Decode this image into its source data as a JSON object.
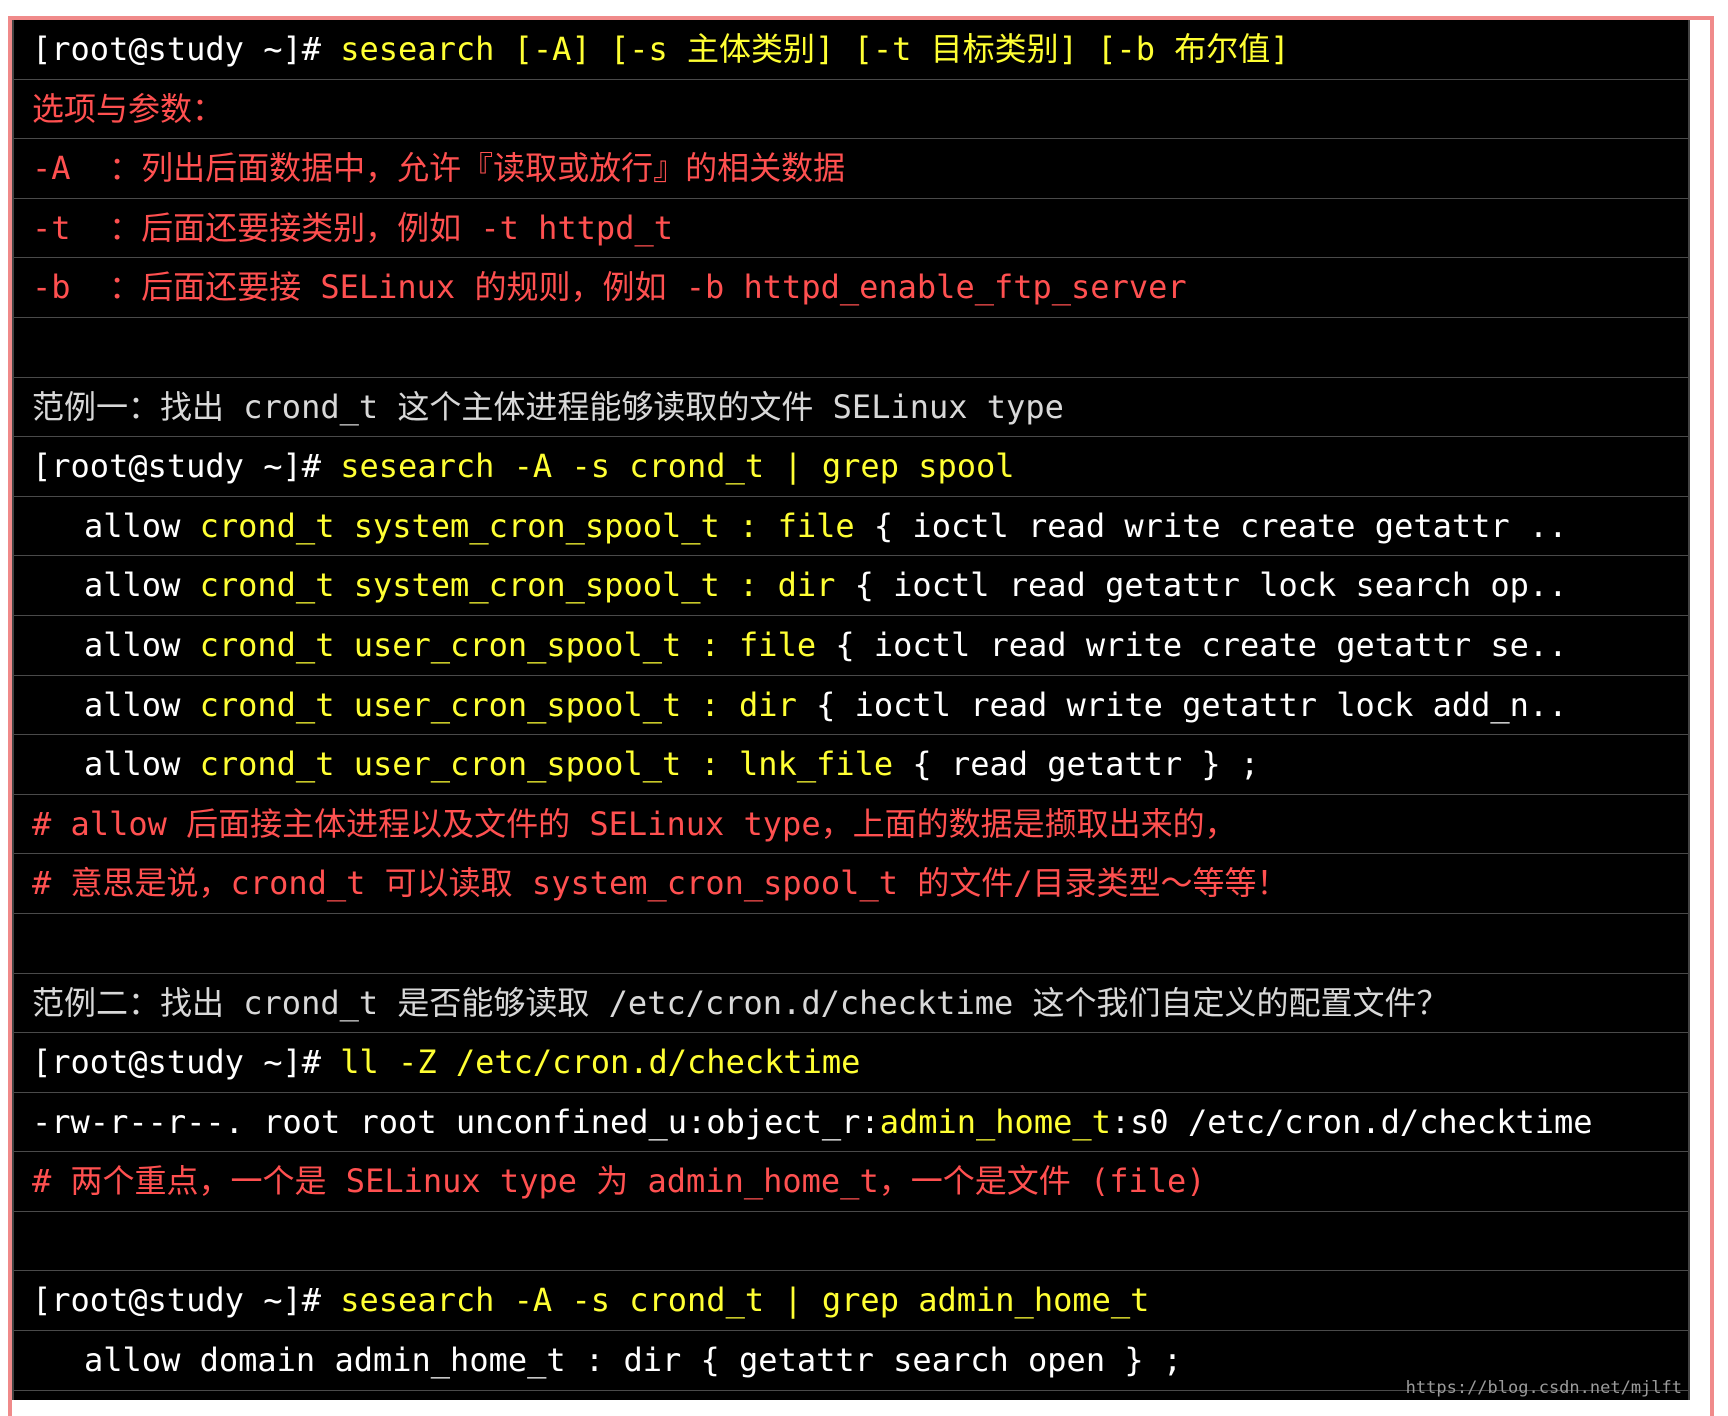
{
  "lines": [
    {
      "prompt": "[root@study ~]# ",
      "cmd": "sesearch [-A] [-s 主体类别] [-t 目标类别] [-b 布尔值]"
    },
    {
      "text": "选项与参数："
    },
    {
      "text": "-A  ：列出后面数据中，允许『读取或放行』的相关数据"
    },
    {
      "text": "-t  ：后面还要接类别，例如 -t httpd_t"
    },
    {
      "text": "-b  ：后面还要接 SELinux 的规则，例如 -b httpd_enable_ftp_server"
    },
    {
      "text": ""
    },
    {
      "text": "范例一：找出 crond_t 这个主体进程能够读取的文件 SELinux type"
    },
    {
      "prompt": "[root@study ~]# ",
      "cmd": "sesearch -A -s crond_t | grep spool"
    },
    {
      "a": "allow ",
      "b": "crond_t system_cron_spool_t : file ",
      "c": "{ ioctl read write create getattr .."
    },
    {
      "a": "allow ",
      "b": "crond_t system_cron_spool_t : dir ",
      "c": "{ ioctl read getattr lock search op.."
    },
    {
      "a": "allow ",
      "b": "crond_t user_cron_spool_t : file ",
      "c": "{ ioctl read write create getattr se.."
    },
    {
      "a": "allow ",
      "b": "crond_t user_cron_spool_t : dir ",
      "c": "{ ioctl read write getattr lock add_n.."
    },
    {
      "a": "allow ",
      "b": "crond_t user_cron_spool_t : lnk_file ",
      "c": "{ read getattr } ;"
    },
    {
      "text": "# allow 后面接主体进程以及文件的 SELinux type，上面的数据是撷取出来的，"
    },
    {
      "text": "# 意思是说，crond_t 可以读取 system_cron_spool_t 的文件/目录类型～等等！"
    },
    {
      "text": ""
    },
    {
      "text": "范例二：找出 crond_t 是否能够读取 /etc/cron.d/checktime 这个我们自定义的配置文件？"
    },
    {
      "prompt": "[root@study ~]# ",
      "cmd": "ll -Z /etc/cron.d/checktime"
    },
    {
      "a": "-rw-r--r--. root root unconfined_u:object_r:",
      "b": "admin_home_t",
      "c": ":s0 /etc/cron.d/checktime"
    },
    {
      "text": "# 两个重点，一个是 SELinux type 为 admin_home_t，一个是文件 (file)"
    },
    {
      "text": ""
    },
    {
      "prompt": "[root@study ~]# ",
      "cmd": "sesearch -A -s crond_t | grep admin_home_t"
    },
    {
      "text": "allow domain admin_home_t : dir { getattr search open } ;"
    }
  ],
  "watermark": "https://blog.csdn.net/mjlft"
}
